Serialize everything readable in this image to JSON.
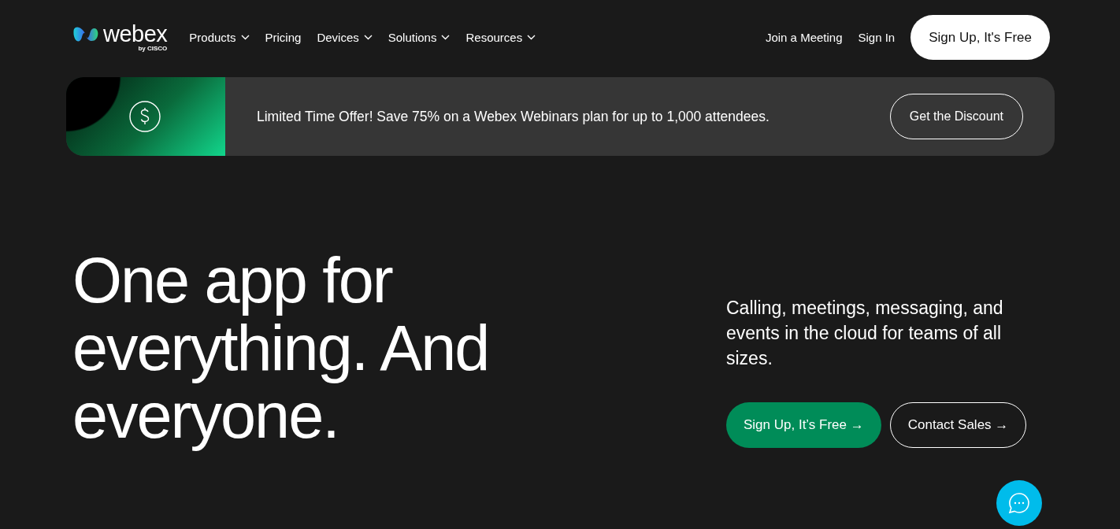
{
  "logo": {
    "wordmark": "webex",
    "byline": "by CISCO"
  },
  "nav": [
    {
      "label": "Products",
      "has_menu": true
    },
    {
      "label": "Pricing",
      "has_menu": false
    },
    {
      "label": "Devices",
      "has_menu": true
    },
    {
      "label": "Solutions",
      "has_menu": true
    },
    {
      "label": "Resources",
      "has_menu": true
    }
  ],
  "header_links": [
    "Join a Meeting",
    "Sign In"
  ],
  "header_button": "Sign Up, It's Free",
  "banner": {
    "text": "Limited Time Offer! Save 75% on a Webex Webinars plan for up to 1,000 attendees.",
    "button": "Get the Discount"
  },
  "hero": {
    "heading": [
      "One app for",
      "everything. And",
      "everyone."
    ],
    "description": "Calling, meetings, messaging, and events in the cloud for teams of all sizes.",
    "buttons": [
      {
        "label": "Sign Up, It’s Free →",
        "kind": "primary"
      },
      {
        "label": "Contact Sales →",
        "kind": "outline"
      }
    ]
  }
}
